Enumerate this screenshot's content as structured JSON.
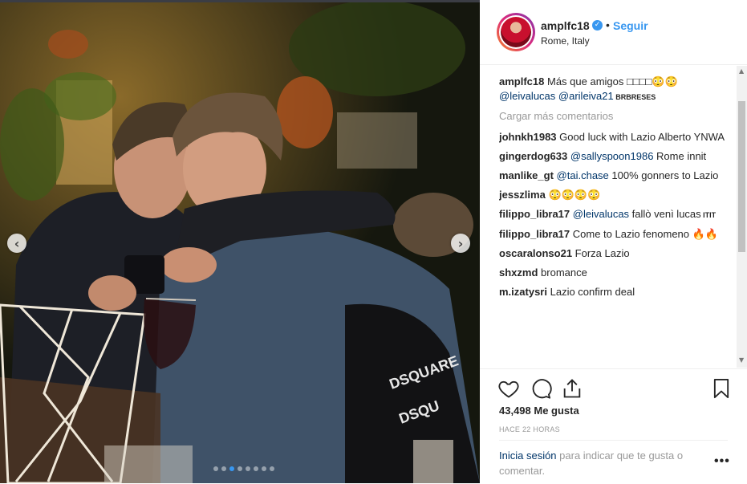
{
  "post": {
    "username": "amplfc18",
    "verified_mark": "✓",
    "separator": "•",
    "follow_label": "Seguir",
    "location": "Rome, Italy"
  },
  "nav": {
    "prev": "‹",
    "next": "›"
  },
  "comments": [
    {
      "user": "amplfc18",
      "parts": [
        {
          "t": "Más que amigos □□□□😳😳 ",
          "k": "text"
        },
        {
          "t": "@leivalucas",
          "k": "mention"
        },
        {
          "t": " ",
          "k": "text"
        },
        {
          "t": "@arileiva21",
          "k": "mention"
        },
        {
          "t": " BRBRESES",
          "k": "small"
        }
      ]
    },
    {
      "user": "johnkh1983",
      "parts": [
        {
          "t": "Good luck with Lazio Alberto YNWA",
          "k": "text"
        }
      ]
    },
    {
      "user": "gingerdog633",
      "parts": [
        {
          "t": "@sallyspoon1986",
          "k": "mention"
        },
        {
          "t": " Rome innit",
          "k": "text"
        }
      ]
    },
    {
      "user": "manlike_gt",
      "parts": [
        {
          "t": "@tai.chase",
          "k": "mention"
        },
        {
          "t": " 100% gonners to Lazio",
          "k": "text"
        }
      ]
    },
    {
      "user": "jesszlima",
      "parts": [
        {
          "t": "😳😳😳😳",
          "k": "text"
        }
      ]
    },
    {
      "user": "filippo_libra17",
      "parts": [
        {
          "t": "@leivalucas",
          "k": "mention"
        },
        {
          "t": " fallò venì lucas",
          "k": "text"
        },
        {
          "t": " ITIT",
          "k": "small"
        }
      ]
    },
    {
      "user": "filippo_libra17",
      "parts": [
        {
          "t": "Come to Lazio fenomeno 🔥🔥",
          "k": "text"
        }
      ]
    },
    {
      "user": "oscaralonso21",
      "parts": [
        {
          "t": "Forza Lazio",
          "k": "text"
        }
      ]
    },
    {
      "user": "shxzmd",
      "parts": [
        {
          "t": "bromance",
          "k": "text"
        }
      ]
    },
    {
      "user": "m.izatysri",
      "parts": [
        {
          "t": "Lazio confirm deal",
          "k": "text"
        }
      ]
    }
  ],
  "load_more": "Cargar más comentarios",
  "likes": "43,498 Me gusta",
  "time_ago": "HACE 22 HORAS",
  "footer": {
    "login_link": "Inicia sesión",
    "rest": " para indicar que te gusta o comentar."
  },
  "more_label": "•••",
  "scroll": {
    "up": "▲",
    "down": "▼"
  },
  "icons": [
    "heart-icon",
    "comment-icon",
    "share-icon",
    "bookmark-icon"
  ],
  "colors": {
    "accent": "#3897f0",
    "mention": "#003569",
    "muted": "#999999"
  },
  "carousel": {
    "slides": 8,
    "active_index": 2
  }
}
